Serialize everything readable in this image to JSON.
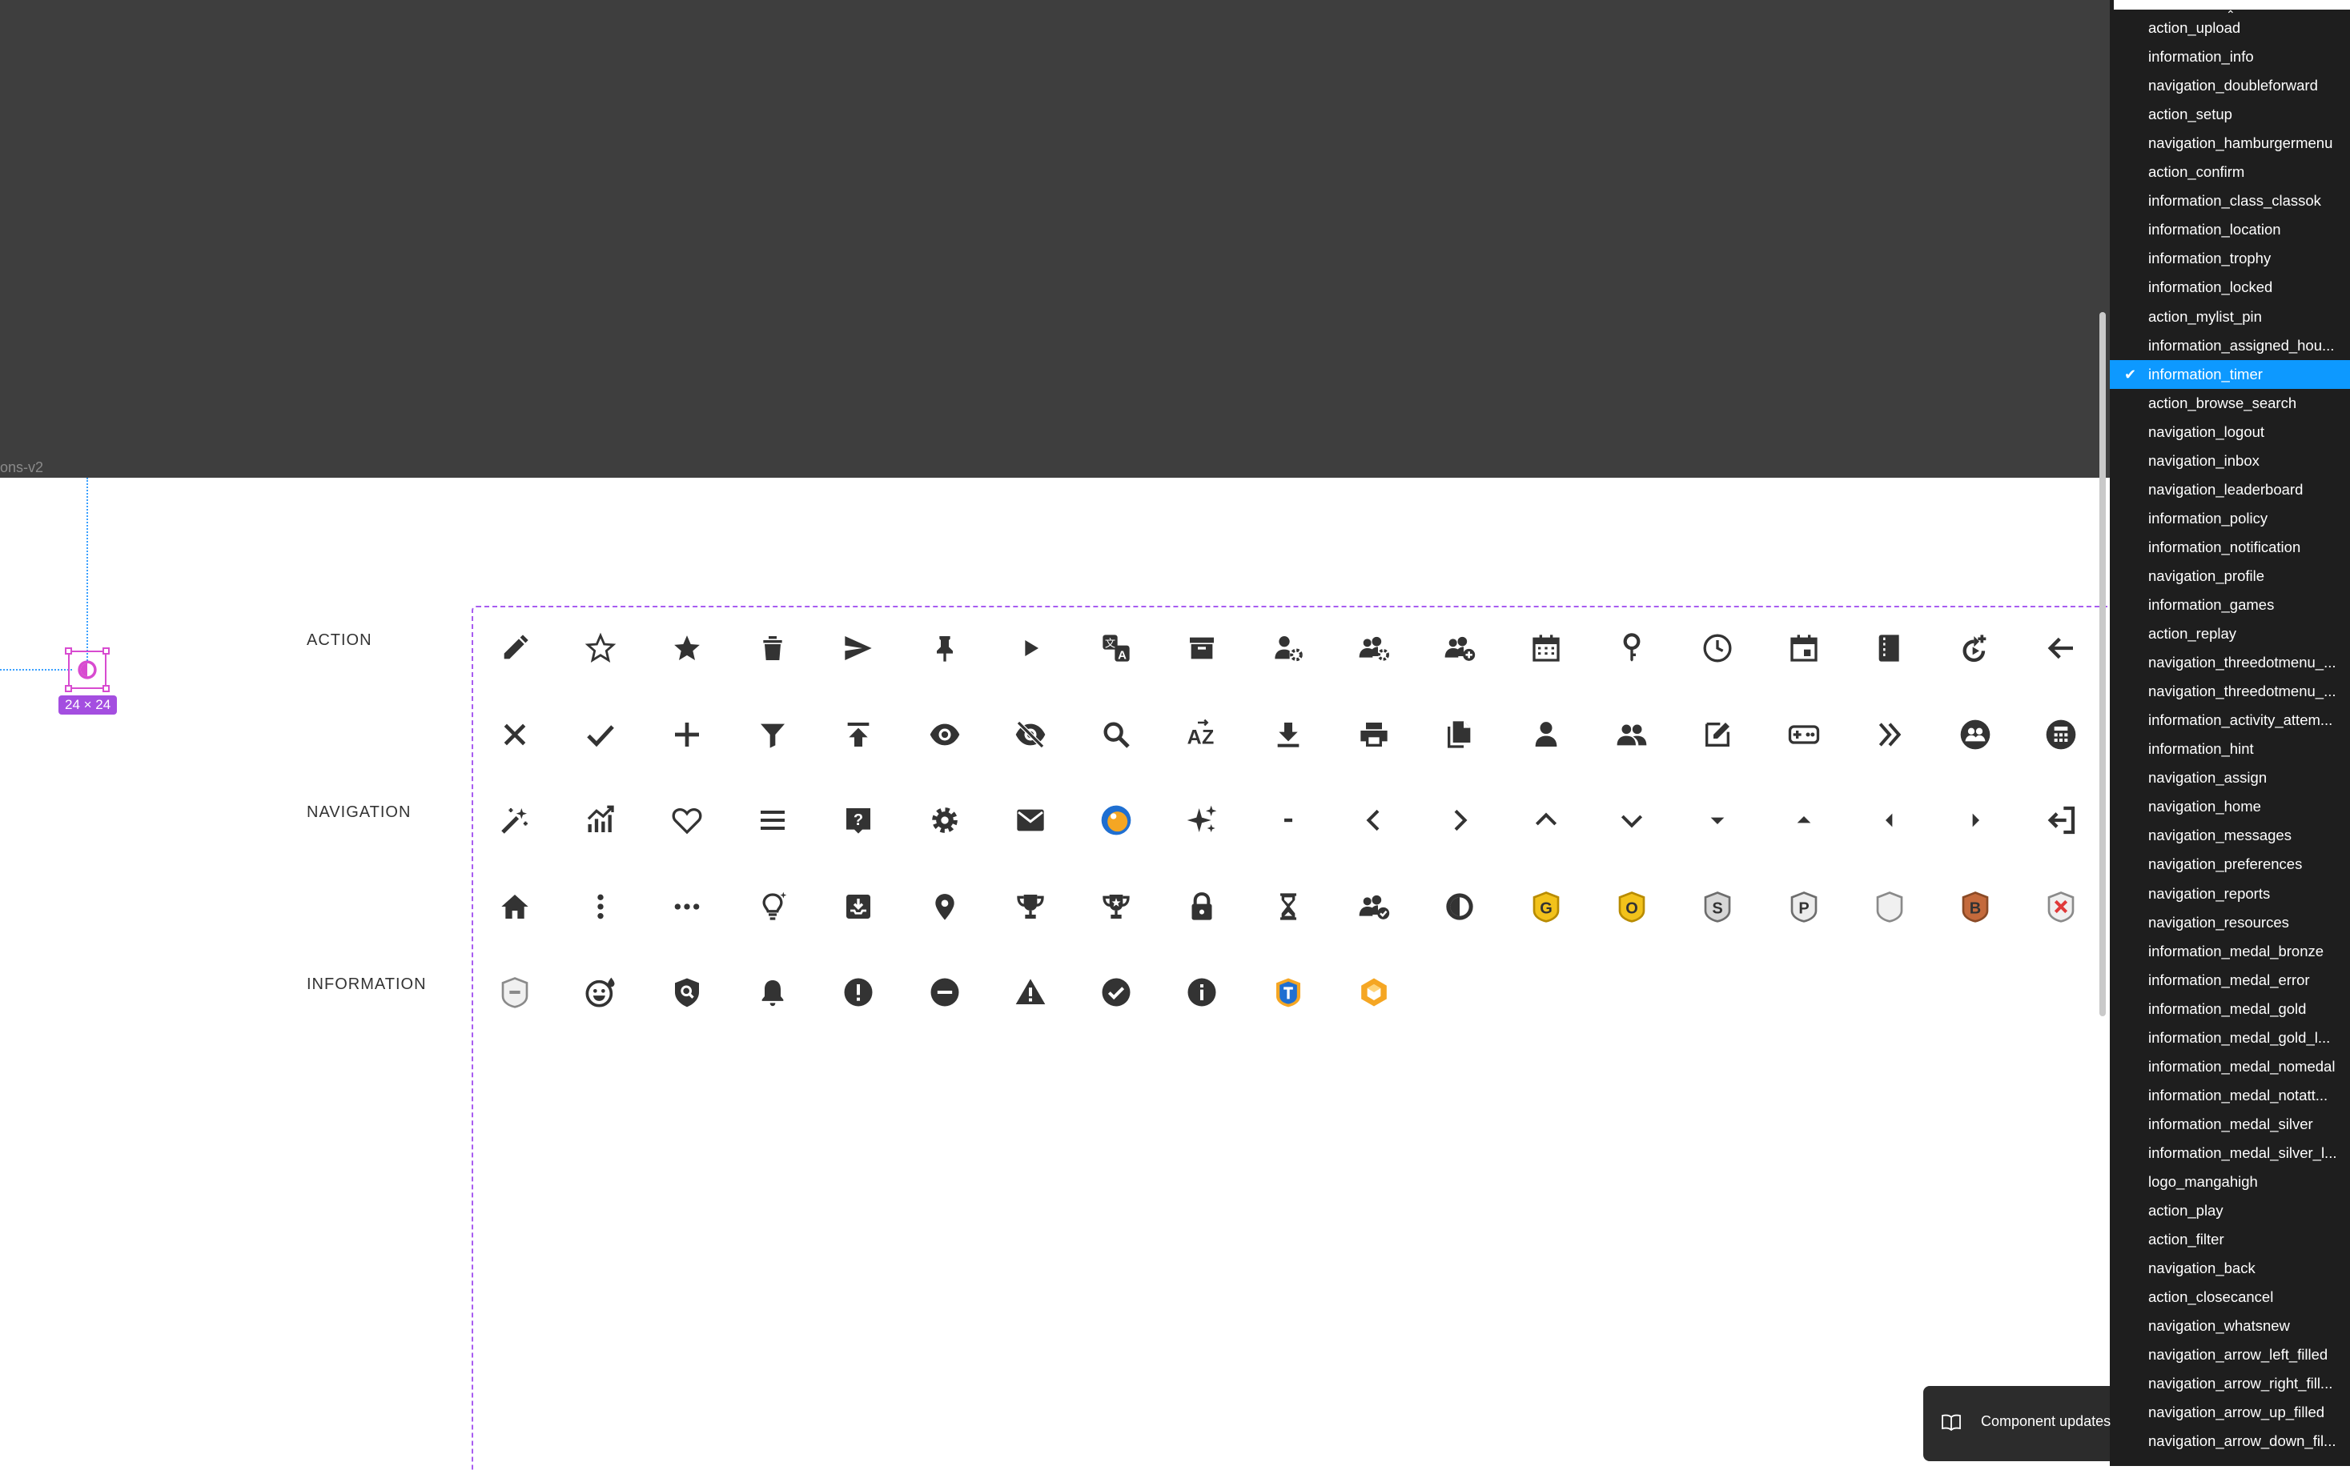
{
  "canvas": {
    "frame_label": "ons-v2",
    "selection_size": "24 × 24"
  },
  "sections": {
    "action": "ACTION",
    "navigation": "NAVIGATION",
    "information": "INFORMATION"
  },
  "icon_rows": [
    [
      "pencil-icon",
      "star-outline-icon",
      "star-filled-icon",
      "trash-icon",
      "send-icon",
      "pin-icon",
      "play-icon",
      "translate-icon",
      "archive-icon",
      "user-settings-icon",
      "group-settings-icon",
      "group-add-icon",
      "calendar-icon",
      "key-icon",
      "clock-icon",
      "calendar-event-icon",
      "book-icon",
      "replay-icon",
      "arrow-left-icon"
    ],
    [
      "close-icon",
      "check-icon",
      "plus-icon",
      "filter-icon",
      "upload-icon",
      "eye-icon",
      "eye-off-icon",
      "search-icon",
      "sort-az-icon",
      "download-icon",
      "printer-icon",
      "copy-icon",
      "person-icon",
      "people-icon",
      "edit-note-icon",
      "gamepad-icon",
      "double-chevron-right-icon",
      "group-circle-icon",
      "calculator-icon"
    ],
    [
      "magic-wand-icon",
      "growth-chart-icon",
      "heart-icon",
      "hamburger-menu-icon",
      "help-icon",
      "gear-icon",
      "mail-icon",
      "mangahigh-logo-icon",
      "sparkles-icon",
      "minus-icon",
      "chevron-left-icon",
      "chevron-right-icon",
      "chevron-up-icon",
      "chevron-down-icon",
      "arrow-down-filled-icon",
      "arrow-up-filled-icon",
      "arrow-left-filled-icon",
      "arrow-right-filled-icon",
      "logout-icon"
    ],
    [
      "home-icon",
      "dots-vertical-icon",
      "dots-horizontal-icon",
      "lightbulb-icon",
      "inbox-icon",
      "location-icon",
      "trophy-icon",
      "trophy-filled-icon",
      "lock-icon",
      "hourglass-icon",
      "group-check-icon",
      "timer-icon",
      "medal-gold-icon",
      "medal-gold-o-icon",
      "medal-silver-icon",
      "medal-platinum-icon",
      "medal-nomedal-icon",
      "medal-bronze-icon",
      "medal-error-icon"
    ],
    [
      "medal-notattempted-icon",
      "happy-face-icon",
      "shield-search-icon",
      "bell-icon",
      "alert-circle-icon",
      "minus-circle-icon",
      "warning-icon",
      "check-circle-icon",
      "info-icon",
      "badge-blue-icon",
      "hexagon-icon"
    ]
  ],
  "dropdown": {
    "selected": "information_timer",
    "items": [
      "action_upload",
      "information_info",
      "navigation_doubleforward",
      "action_setup",
      "navigation_hamburgermenu",
      "action_confirm",
      "information_class_classok",
      "information_location",
      "information_trophy",
      "information_locked",
      "action_mylist_pin",
      "information_assigned_hou...",
      "information_timer",
      "action_browse_search",
      "navigation_logout",
      "navigation_inbox",
      "navigation_leaderboard",
      "information_policy",
      "information_notification",
      "navigation_profile",
      "information_games",
      "action_replay",
      "navigation_threedotmenu_...",
      "navigation_threedotmenu_...",
      "information_activity_attem...",
      "information_hint",
      "navigation_assign",
      "navigation_home",
      "navigation_messages",
      "navigation_preferences",
      "navigation_reports",
      "navigation_resources",
      "information_medal_bronze",
      "information_medal_error",
      "information_medal_gold",
      "information_medal_gold_l...",
      "information_medal_nomedal",
      "information_medal_notatt...",
      "information_medal_silver",
      "information_medal_silver_l...",
      "logo_mangahigh",
      "action_play",
      "action_filter",
      "navigation_back",
      "action_closecancel",
      "navigation_whatsnew",
      "navigation_arrow_left_filled",
      "navigation_arrow_right_fill...",
      "navigation_arrow_up_filled",
      "navigation_arrow_down_fil..."
    ]
  },
  "toast": {
    "label": "Component updates"
  },
  "colors": {
    "canvas_dark": "#3e3e3e",
    "selection": "#d84bd0",
    "badge": "#a44ee0",
    "frame_dash": "#a85cf0",
    "menu_bg": "#1e1e1e",
    "menu_selected": "#0d99ff",
    "icon": "#333333",
    "gold": "#f2c21b",
    "silver": "#9a9a9a",
    "bronze": "#c46a3c",
    "error": "#e03a3a",
    "orange": "#f5a623",
    "blue": "#1f6fd1"
  }
}
